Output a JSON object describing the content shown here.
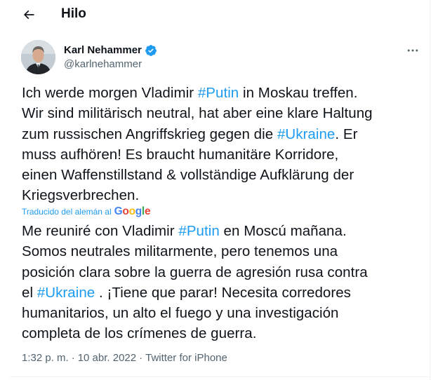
{
  "header": {
    "title": "Hilo"
  },
  "author": {
    "name": "Karl Nehammer",
    "handle": "@karlnehammer"
  },
  "tweet": {
    "lines": [
      [
        "Ich werde morgen Vladimir ",
        "#Putin",
        " in Moskau treffen."
      ],
      [
        "Wir sind militärisch neutral, hat aber eine klare Haltung"
      ],
      [
        "zum russischen Angriffskrieg gegen die ",
        "#Ukraine",
        ". Er"
      ],
      [
        "muss aufhören! Es braucht humanitäre Korridore,"
      ],
      [
        "einen Waffenstillstand & vollständige Aufklärung der"
      ],
      [
        "Kriegsverbrechen."
      ]
    ]
  },
  "translation": {
    "label": "Traducido del alemán al",
    "provider": "Google",
    "lines": [
      [
        "Me reuniré con Vladimir ",
        "#Putin",
        " en Moscú mañana."
      ],
      [
        "Somos neutrales militarmente, pero tenemos una"
      ],
      [
        "posición clara sobre la guerra de agresión rusa contra"
      ],
      [
        "el ",
        "#Ukraine",
        " . ¡Tiene que parar! Necesita corredores"
      ],
      [
        "humanitarios, un alto el fuego y una investigación"
      ],
      [
        "completa de los crímenes de guerra."
      ]
    ]
  },
  "meta": {
    "time": "1:32 p. m.",
    "separator": "·",
    "date": "10 abr. 2022",
    "source": "Twitter for iPhone"
  },
  "colors": {
    "accent": "#1d9bf0",
    "text": "#0f1419",
    "secondary": "#536471"
  },
  "icons": {
    "back": "arrow-left-icon",
    "verified": "verified-badge-icon",
    "more": "more-horizontal-icon"
  }
}
